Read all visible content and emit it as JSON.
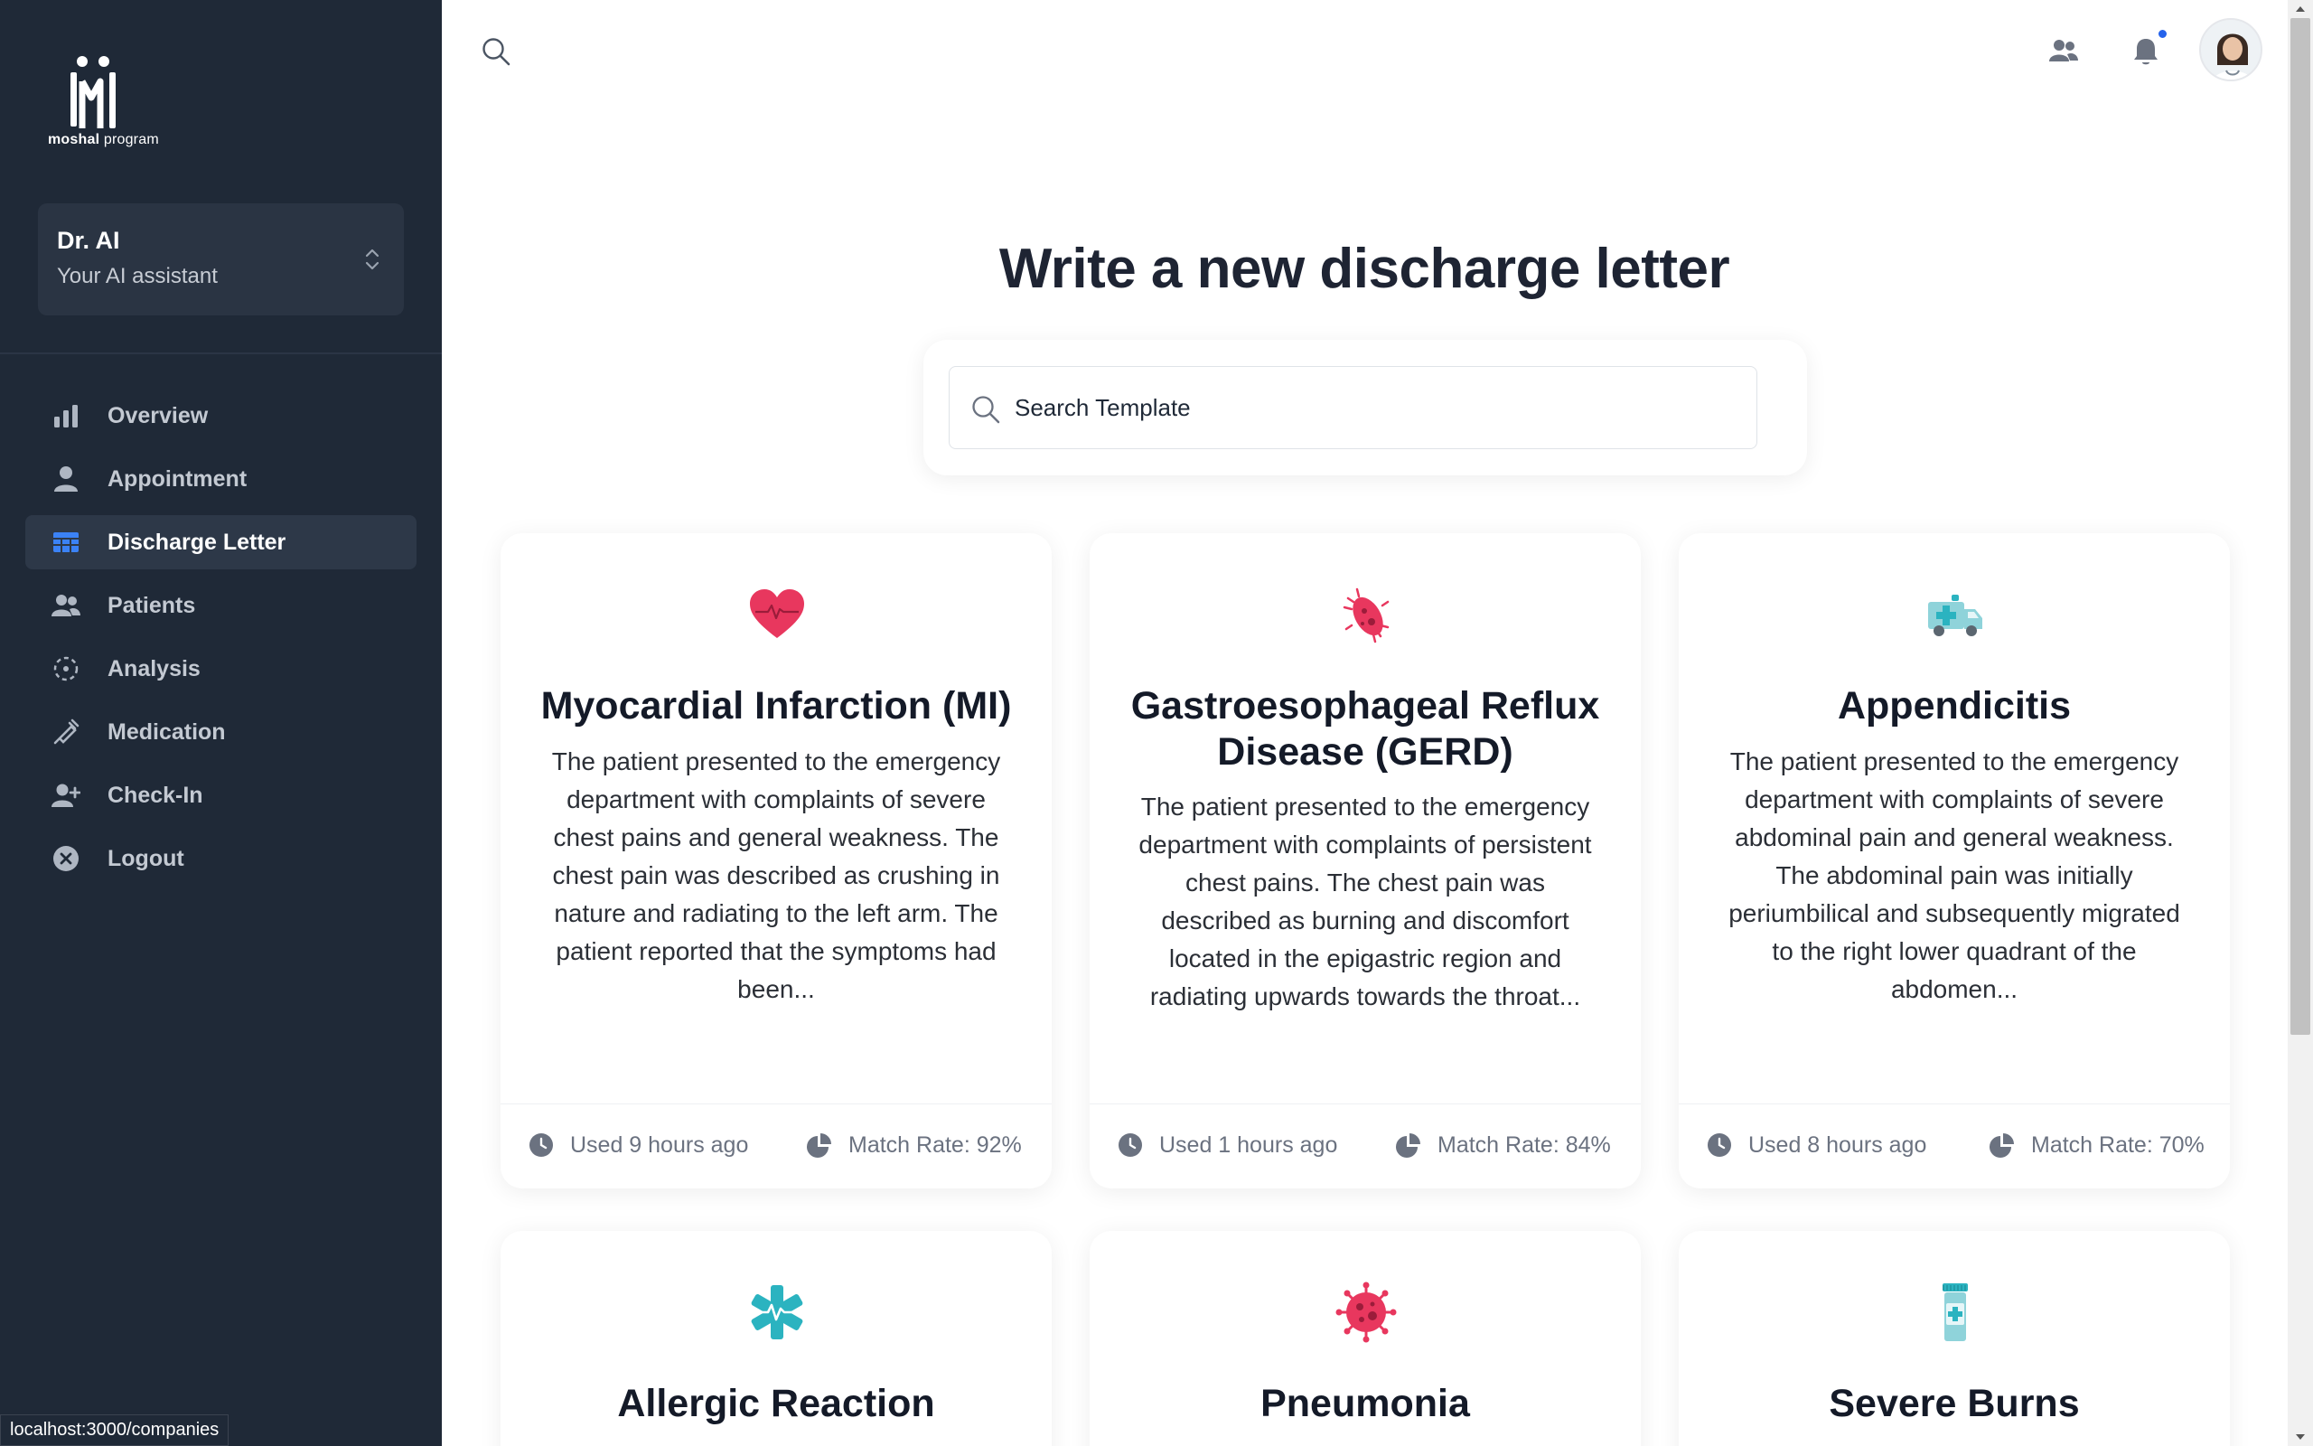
{
  "brand": {
    "name_bold": "moshal",
    "name_light": " program"
  },
  "assistant": {
    "name": "Dr. AI",
    "role": "Your AI assistant"
  },
  "nav": [
    {
      "label": "Overview",
      "icon": "bar-chart-icon",
      "active": false
    },
    {
      "label": "Appointment",
      "icon": "user-icon",
      "active": false
    },
    {
      "label": "Discharge Letter",
      "icon": "table-icon",
      "active": true
    },
    {
      "label": "Patients",
      "icon": "users-icon",
      "active": false
    },
    {
      "label": "Analysis",
      "icon": "target-icon",
      "active": false
    },
    {
      "label": "Medication",
      "icon": "syringe-icon",
      "active": false
    },
    {
      "label": "Check-In",
      "icon": "user-plus-icon",
      "active": false
    },
    {
      "label": "Logout",
      "icon": "close-circle-icon",
      "active": false
    }
  ],
  "status_url": "localhost:3000/companies",
  "page_title": "Write a new discharge letter",
  "search": {
    "placeholder": "Search Template"
  },
  "cards": [
    {
      "title": "Myocardial Infarction (MI)",
      "icon": "heart-pulse-icon",
      "description": "The patient presented to the emergency department with complaints of severe chest pains and general weakness. The chest pain was described as crushing in nature and radiating to the left arm. The patient reported that the symptoms had been...",
      "used": "Used 9 hours ago",
      "match": "Match Rate: 92%"
    },
    {
      "title": "Gastroesophageal Reflux Disease (GERD)",
      "icon": "bacteria-icon",
      "description": "The patient presented to the emergency department with complaints of persistent chest pains. The chest pain was described as burning and discomfort located in the epigastric region and radiating upwards towards the throat...",
      "used": "Used 1 hours ago",
      "match": "Match Rate: 84%"
    },
    {
      "title": "Appendicitis",
      "icon": "ambulance-icon",
      "description": "The patient presented to the emergency department with complaints of severe abdominal pain and general weakness. The abdominal pain was initially periumbilical and subsequently migrated to the right lower quadrant of the abdomen...",
      "used": "Used 8 hours ago",
      "match": "Match Rate: 70%"
    },
    {
      "title": "Allergic Reaction",
      "icon": "medical-star-icon"
    },
    {
      "title": "Pneumonia",
      "icon": "virus-icon"
    },
    {
      "title": "Severe Burns",
      "icon": "medicine-bottle-icon"
    }
  ],
  "colors": {
    "sidebar": "#1f2937",
    "accent_red": "#e8375e",
    "accent_teal": "#2bb3c0",
    "notification_dot": "#2563eb"
  }
}
